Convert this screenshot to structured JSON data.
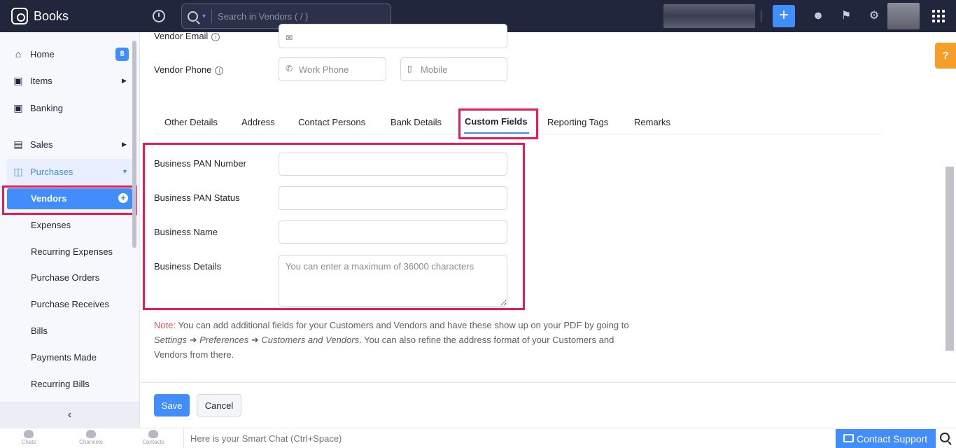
{
  "app": {
    "name": "Books"
  },
  "search": {
    "placeholder": "Search in Vendors ( / )"
  },
  "sidebar": {
    "items": [
      {
        "label": "Home",
        "badge": "8"
      },
      {
        "label": "Items"
      },
      {
        "label": "Banking"
      },
      {
        "label": "Sales"
      },
      {
        "label": "Purchases"
      }
    ],
    "purchases_sub": [
      "Vendors",
      "Expenses",
      "Recurring Expenses",
      "Purchase Orders",
      "Purchase Receives",
      "Bills",
      "Payments Made",
      "Recurring Bills"
    ],
    "collapse": "‹"
  },
  "form": {
    "vendor_email_label": "Vendor Email",
    "vendor_phone_label": "Vendor Phone",
    "work_phone_placeholder": "Work Phone",
    "mobile_placeholder": "Mobile"
  },
  "tabs": [
    "Other Details",
    "Address",
    "Contact Persons",
    "Bank Details",
    "Custom Fields",
    "Reporting Tags",
    "Remarks"
  ],
  "custom_fields": {
    "pan_number_label": "Business PAN Number",
    "pan_status_label": "Business PAN Status",
    "name_label": "Business Name",
    "details_label": "Business Details",
    "details_placeholder": "You can enter a maximum of 36000 characters"
  },
  "note": {
    "prefix": "Note:",
    "text1": " You can add additional fields for your Customers and Vendors and have these show up on your PDF by going to ",
    "settings": "Settings",
    "preferences": "Preferences",
    "customers_vendors": "Customers and Vendors",
    "text2": ". You can also refine the address format of your Customers and Vendors from there."
  },
  "actions": {
    "save": "Save",
    "cancel": "Cancel"
  },
  "help": "?",
  "bottombar": {
    "chats": "Chats",
    "channels": "Channels",
    "contacts": "Contacts",
    "smart_chat_placeholder": "Here is your Smart Chat (Ctrl+Space)",
    "support": "Contact Support"
  },
  "colors": {
    "accent": "#408dfb",
    "highlight": "#f0185a",
    "topbar": "#21263c",
    "help": "#f79d2a"
  }
}
